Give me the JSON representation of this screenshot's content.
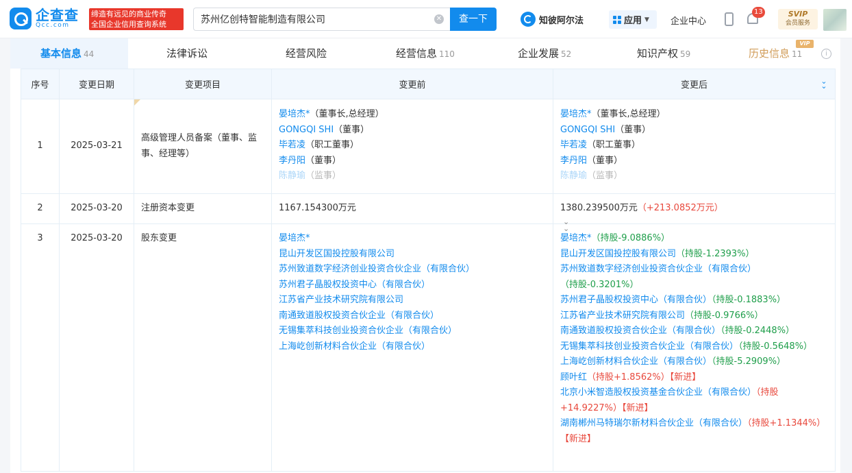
{
  "header": {
    "logo_cn": "企查查",
    "logo_en": "Qcc.com",
    "slogan_line1": "缔造有远见的商业传奇",
    "slogan_line2": "全国企业信用查询系统",
    "search_value": "苏州亿创特智能制造有限公司",
    "search_button": "查一下",
    "zhibi": "知彼阿尔法",
    "app": "应用",
    "enterprise_center": "企业中心",
    "notification_count": "13",
    "svip_top": "SVIP",
    "svip_bottom": "会员服务"
  },
  "tabs": [
    {
      "label": "基本信息",
      "count": "44"
    },
    {
      "label": "法律诉讼",
      "count": ""
    },
    {
      "label": "经营风险",
      "count": ""
    },
    {
      "label": "经营信息",
      "count": "110"
    },
    {
      "label": "企业发展",
      "count": "52"
    },
    {
      "label": "知识产权",
      "count": "59"
    },
    {
      "label": "历史信息",
      "count": "11"
    }
  ],
  "vip_tag": "VIP",
  "table": {
    "headers": [
      "序号",
      "变更日期",
      "变更项目",
      "变更前",
      "变更后"
    ],
    "rows": [
      {
        "no": "1",
        "date": "2025-03-21",
        "item": "高级管理人员备案（董事、监事、经理等）",
        "before": [
          {
            "name": "晏培杰*",
            "role": "（董事长,总经理）"
          },
          {
            "name": "GONGQI SHI",
            "role": "（董事）"
          },
          {
            "name": "毕若凌",
            "role": "（职工董事）"
          },
          {
            "name": "李丹阳",
            "role": "（董事）"
          },
          {
            "name": "陈静瑜",
            "role": "（监事）"
          }
        ],
        "after": [
          {
            "name": "晏培杰*",
            "role": "（董事长,总经理）"
          },
          {
            "name": "GONGQI SHI",
            "role": "（董事）"
          },
          {
            "name": "毕若凌",
            "role": "（职工董事）"
          },
          {
            "name": "李丹阳",
            "role": "（董事）"
          },
          {
            "name": "陈静瑜",
            "role": "（监事）"
          }
        ]
      },
      {
        "no": "2",
        "date": "2025-03-20",
        "item": "注册资本变更",
        "before": "1167.154300万元",
        "after": "1380.239500万元",
        "after_delta": "（+213.0852万元）"
      },
      {
        "no": "3",
        "date": "2025-03-20",
        "item": "股东变更",
        "before": [
          "晏培杰*",
          "昆山开发区国投控股有限公司",
          "苏州致道数字经济创业投资合伙企业（有限合伙）",
          "苏州君子晶股权投资中心（有限合伙）",
          "江苏省产业技术研究院有限公司",
          "南通致道股权投资合伙企业（有限合伙）",
          "无锡集萃科技创业投资合伙企业（有限合伙）",
          "上海屹创新材料合伙企业（有限合伙）"
        ],
        "after": [
          {
            "line1": "晏培杰*",
            "share": "（持股-9.0886%）",
            "new": ""
          },
          {
            "line1": "昆山开发区国投控股有限公司",
            "share": "（持股-1.2393%）",
            "new": ""
          },
          {
            "line1": "苏州致道数字经济创业投资合伙企业（有限合伙）",
            "share": "（持股-0.3201%）",
            "new": ""
          },
          {
            "line1": "苏州君子晶股权投资中心（有限合伙）",
            "share": "（持股-0.1883%）",
            "new": ""
          },
          {
            "line1": "江苏省产业技术研究院有限公司",
            "share": "（持股-0.9766%）",
            "new": ""
          },
          {
            "line1": "南通致道股权投资合伙企业（有限合伙）",
            "share": "（持股-0.2448%）",
            "new": ""
          },
          {
            "line1": "无锡集萃科技创业投资合伙企业（有限合伙）",
            "share": "（持股-0.5648%）",
            "new": ""
          },
          {
            "line1": "上海屹创新材料合伙企业（有限合伙）",
            "share": "（持股-5.2909%）",
            "new": ""
          },
          {
            "line1": "顾叶红",
            "share": "（持股+1.8562%）",
            "new": "【新进】"
          },
          {
            "line1": "北京小米智造股权投资基金合伙企业（有限合伙）",
            "share": "（持股+14.9227%）",
            "new": "【新进】"
          },
          {
            "line1": "湖南郴州马特瑞尔新材料合伙企业（有限合伙）",
            "share": "（持股+1.1344%）",
            "new": "【新进】"
          }
        ]
      }
    ]
  },
  "colors": {
    "brand": "#128bed",
    "increase": "#e8483c",
    "decrease": "#1e9e4a",
    "slogan_bg": "#e8372b"
  }
}
